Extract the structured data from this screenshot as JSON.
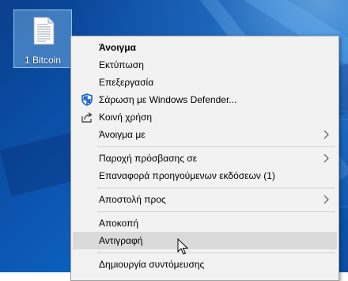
{
  "desktop": {
    "icon": {
      "label": "1 Bitcoin",
      "icon": "text-file-icon"
    }
  },
  "context_menu": {
    "items": [
      {
        "label": "Άνοιγμα",
        "bold": true
      },
      {
        "label": "Εκτύπωση"
      },
      {
        "label": "Επεξεργασία"
      },
      {
        "label": "Σάρωση με Windows Defender...",
        "icon": "windows-defender-shield-icon"
      },
      {
        "label": "Κοινή χρήση",
        "icon": "share-icon"
      },
      {
        "label": "Άνοιγμα με",
        "submenu": true
      },
      {
        "label": "Παροχή πρόσβασης σε",
        "submenu": true
      },
      {
        "label": "Επαναφορά προηγούμενων εκδόσεων (1)"
      },
      {
        "label": "Αποστολή προς",
        "submenu": true
      },
      {
        "label": "Αποκοπή"
      },
      {
        "label": "Αντιγραφή",
        "highlighted": true
      },
      {
        "label": "Δημιουργία συντόμευσης"
      }
    ]
  },
  "colors": {
    "menu_background": "#f2f2f2",
    "highlight": "#dadada",
    "defender_blue": "#1a64c8"
  }
}
